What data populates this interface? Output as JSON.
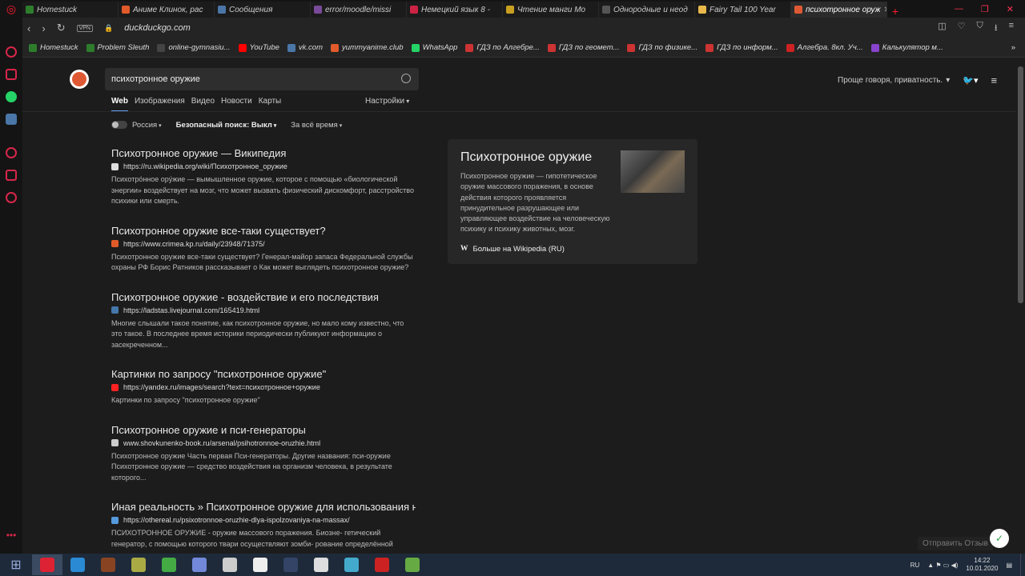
{
  "browser": {
    "tabs": [
      {
        "title": "Homestuck",
        "color": "#2d7d2d",
        "active": false
      },
      {
        "title": "Аниме Клинок, рас",
        "color": "#e05a2a",
        "active": false
      },
      {
        "title": "Сообщения",
        "color": "#4a76a8",
        "active": false
      },
      {
        "title": "error/moodle/missi",
        "color": "#7a4a9a",
        "active": false
      },
      {
        "title": "Немецкий язык 8 -",
        "color": "#cc2244",
        "active": false
      },
      {
        "title": "Чтение манги Мо",
        "color": "#c8a020",
        "active": false
      },
      {
        "title": "Однородные и неод",
        "color": "#555555",
        "active": false
      },
      {
        "title": "Fairy Tail 100 Year",
        "color": "#e8b84a",
        "active": false
      },
      {
        "title": "психотронное оруж",
        "color": "#de5833",
        "active": true
      }
    ],
    "url": "duckduckgo.com",
    "vpn_label": "VPN",
    "bookmarks": [
      {
        "label": "Homestuck",
        "color": "#2d7d2d"
      },
      {
        "label": "Problem Sleuth",
        "color": "#2d7d2d"
      },
      {
        "label": "online-gymnasiu...",
        "color": "#444444"
      },
      {
        "label": "YouTube",
        "color": "#ff0000"
      },
      {
        "label": "vk.com",
        "color": "#4a76a8"
      },
      {
        "label": "yummyanime.club",
        "color": "#e05a2a"
      },
      {
        "label": "WhatsApp",
        "color": "#25d366"
      },
      {
        "label": "ГДЗ по Алгебре...",
        "color": "#cc3333"
      },
      {
        "label": "ГДЗ по геомет...",
        "color": "#cc3333"
      },
      {
        "label": "ГДЗ по физике...",
        "color": "#cc3333"
      },
      {
        "label": "ГДЗ по информ...",
        "color": "#cc3333"
      },
      {
        "label": "Алгебра. 8кл. Уч...",
        "color": "#cc2222"
      },
      {
        "label": "Калькулятор м...",
        "color": "#8844cc"
      }
    ],
    "more_icon": "»"
  },
  "search": {
    "query": "психотронное оружие",
    "tabs": [
      "Web",
      "Изображения",
      "Видео",
      "Новости",
      "Карты"
    ],
    "settings_label": "Настройки",
    "header_right_label": "Проще говоря, приватность.",
    "filters": {
      "region": "Россия",
      "safe_search": "Безопасный поиск: Выкл",
      "time": "За всё время"
    }
  },
  "results": [
    {
      "title": "Психотронное оружие — Википедия",
      "url": "https://ru.wikipedia.org/wiki/Психотронное_оружие",
      "favicon_color": "#dddddd",
      "snippet": "Психотро́нное ору́жие — вымышленное оружие, которое с помощью «биологической энергии» воздействует на мозг, что может вызвать физический дискомфорт, расстройство психики или смерть."
    },
    {
      "title": "Психотронное оружие все-таки существует?",
      "url": "https://www.crimea.kp.ru/daily/23948/71375/",
      "favicon_color": "#e05a2a",
      "snippet": "Психотронное оружие все-таки существует? Генерал-майор запаса Федеральной службы охраны РФ Борис Ратников рассказывает о Как может выглядеть психотронное оружие?"
    },
    {
      "title": "Психотронное оружие - воздействие и его последствия",
      "url": "https://ladstas.livejournal.com/165419.html",
      "favicon_color": "#4477aa",
      "snippet": "Многие слышали такое понятие, как психотронное оружие, но мало кому известно, что это такое. В последнее время историки периодически публикуют информацию о засекреченном..."
    },
    {
      "title": "Картинки по запросу \"психотронное оружие\"",
      "url": "https://yandex.ru/images/search?text=психотронное+оружие",
      "favicon_color": "#ff2222",
      "snippet": "Картинки по запросу \"психотронное оружие\""
    },
    {
      "title": "Психотронное оружие и пси-генераторы",
      "url": "www.shovkunenko-book.ru/arsenal/psihotronnoe-oruzhie.html",
      "favicon_color": "#cccccc",
      "snippet": "Психотронное оружие Часть первая Пси-генераторы. Другие названия: пси-оружие Психотронное оружие — средство воздействия на организм человека, в результате которого..."
    },
    {
      "title": "Иная реальность » Психотронное оружие для использования н...",
      "url": "https://othereal.ru/psixotronnoe-oruzhie-dlya-ispolzovaniya-na-massax/",
      "favicon_color": "#5599dd",
      "snippet": "ПСИХОТРОННОЕ ОРУЖИЕ - оружие массового поражения. Биозне- гетический генератор, с помощью которого твари осуществляют зомби- рование определённой"
    }
  ],
  "infobox": {
    "title": "Психотронное оружие",
    "text": "Психотронное оружие — гипотетическое оружие массового поражения, в основе действия которого проявляется принудительное разрушающее или управляющее воздействие на человеческую психику и психику животных, мозг.",
    "more_link": "Больше на Wikipedia (RU)"
  },
  "feedback_label": "Отправить Отзыв",
  "taskbar": {
    "apps": [
      {
        "color": "#dd2233"
      },
      {
        "color": "#2a8ad4"
      },
      {
        "color": "#884422"
      },
      {
        "color": "#aaaa44"
      },
      {
        "color": "#44aa44"
      },
      {
        "color": "#7289da"
      },
      {
        "color": "#cccccc"
      },
      {
        "color": "#eeeeee"
      },
      {
        "color": "#334466"
      },
      {
        "color": "#dddddd"
      },
      {
        "color": "#44aacc"
      },
      {
        "color": "#cc2222"
      },
      {
        "color": "#66aa44"
      }
    ],
    "lang": "RU",
    "time": "14:22",
    "date": "10.01.2020"
  }
}
